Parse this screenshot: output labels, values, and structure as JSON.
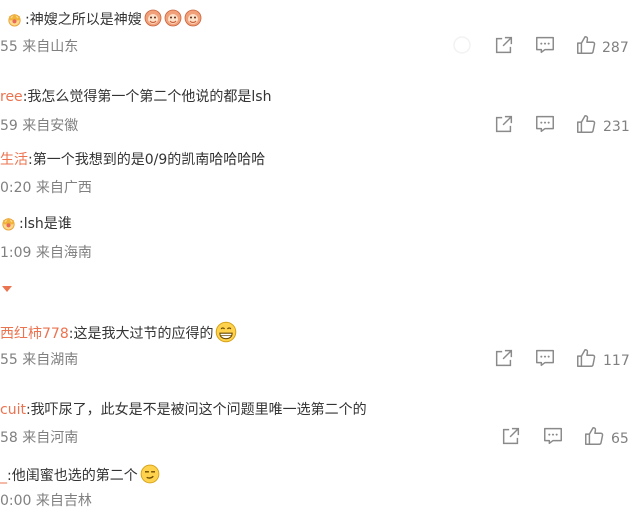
{
  "comments": [
    {
      "author": "",
      "text": ":神嫂之所以是神嫂",
      "meta": "55 来自山东",
      "likes": "287"
    },
    {
      "author": "ree",
      "text": ":我怎么觉得第一个第二个他说的都是lsh",
      "meta": "59 来自安徽",
      "likes": "231"
    },
    {
      "author": "生活",
      "text": ":第一个我想到的是0/9的凯南哈哈哈哈",
      "meta": "0:20 来自广西",
      "likes": ""
    },
    {
      "author": "",
      "text": ":lsh是谁",
      "meta": "1:09 来自海南",
      "likes": ""
    },
    {
      "author": "西红柿778",
      "text": ":这是我大过节的应得的",
      "meta": "55 来自湖南",
      "likes": "117"
    },
    {
      "author": "cuit",
      "text": ":我吓尿了，此女是不是被问这个问题里唯一选第二个的",
      "meta": "58 来自河南",
      "likes": "65"
    },
    {
      "author": "_",
      "text": ":他闺蜜也选的第二个",
      "meta": "0:00 来自吉林",
      "likes": ""
    }
  ],
  "colors": {
    "author": "#eb7350",
    "icon": "#8a8a8a",
    "meta": "#808080"
  },
  "icons": {
    "share": "share-icon",
    "comment": "comment-icon",
    "like": "thumbs-up-icon"
  }
}
